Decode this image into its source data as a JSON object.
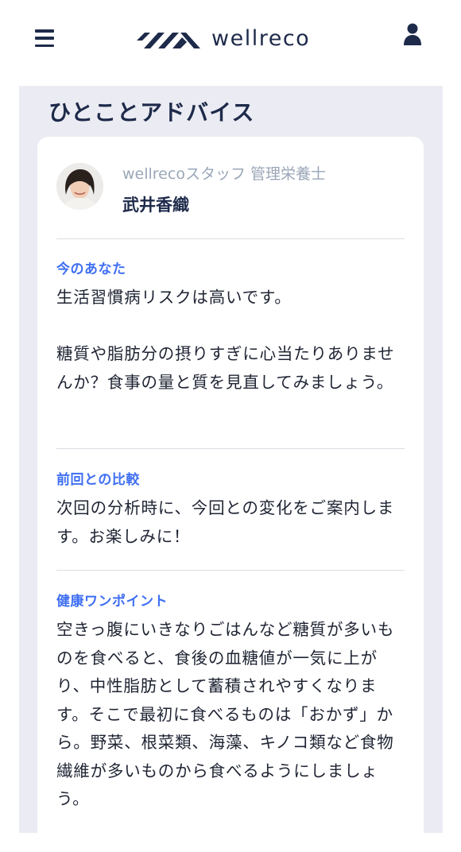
{
  "header": {
    "logo_text": "wellreco",
    "menu_icon": "hamburger-menu-icon",
    "user_icon": "user-icon",
    "brand_color": "#1e2a4a"
  },
  "advice": {
    "title": "ひとことアドバイス",
    "staff": {
      "role": "wellrecoスタッフ 管理栄養士",
      "name": "武井香織"
    },
    "sections": [
      {
        "label": "今のあなた",
        "text": "生活習慣病リスクは高いです。\n\n糖質や脂肪分の摂りすぎに心当たりありませんか？食事の量と質を見直してみましょう。"
      },
      {
        "label": "前回との比較",
        "text": "次回の分析時に、今回との変化をご案内します。お楽しみに！"
      },
      {
        "label": "健康ワンポイント",
        "text": "空きっ腹にいきなりごはんなど糖質が多いものを食べると、食後の血糖値が一気に上がり、中性脂肪として蓄積されやすくなります。そこで最初に食べるものは「おかず」から。野菜、根菜類、海藻、キノコ類など食物繊維が多いものから食べるようにしましょう。"
      }
    ],
    "label_color": "#3f6ff2"
  }
}
